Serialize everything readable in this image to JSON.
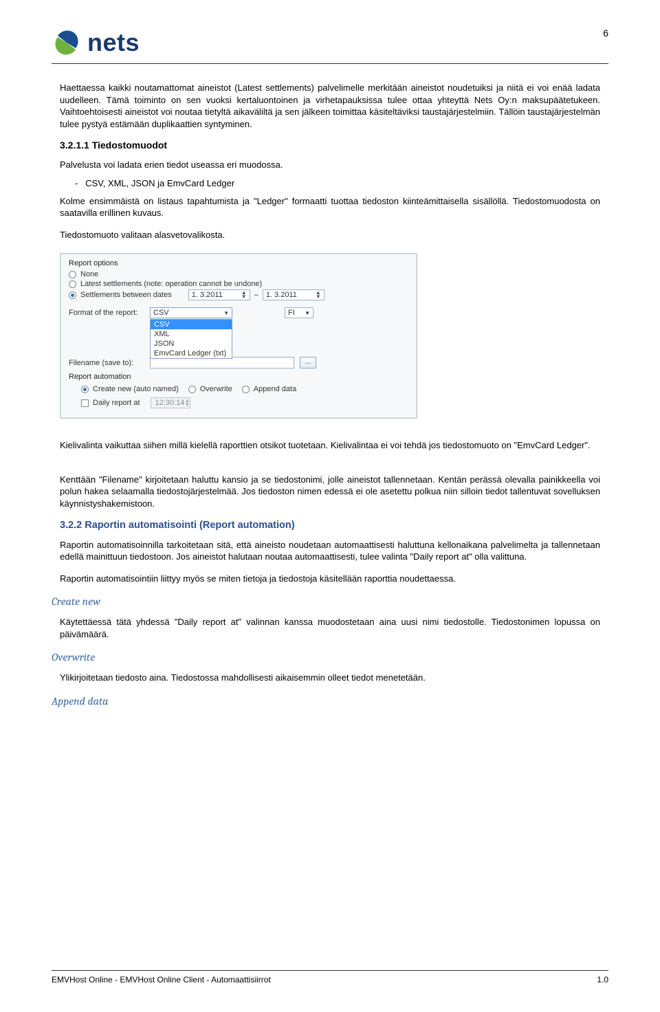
{
  "page_number": "6",
  "logo_text": "nets",
  "paragraphs": {
    "p1": "Haettaessa kaikki noutamattomat aineistot (Latest settlements) palvelimelle merkitään aineistot noudetuiksi ja niitä ei voi enää ladata uudelleen. Tämä toiminto on sen vuoksi kertaluontoinen ja virhetapauksissa tulee ottaa yhteyttä Nets Oy:n maksupäätetukeen. Vaihtoehtoisesti aineistot voi noutaa tietyltä aikaväliltä ja sen jälkeen toimittaa käsiteltäviksi taustajärjestelmiin. Tällöin taustajärjestelmän tulee pystyä estämään duplikaattien syntyminen.",
    "p2": "Palvelusta voi ladata erien tiedot useassa eri muodossa.",
    "p3_list": "CSV, XML, JSON ja EmvCard Ledger",
    "p4": "Kolme ensimmäistä on listaus tapahtumista ja \"Ledger\" formaatti tuottaa tiedoston kiinteämittaisella sisällöllä. Tiedostomuodosta on saatavilla erillinen kuvaus.",
    "p5": "Tiedostomuoto valitaan alasvetovalikosta.",
    "p6": "Kielivalinta vaikuttaa siihen millä kielellä raporttien otsikot tuotetaan. Kielivalintaa ei voi tehdä jos tiedostomuoto on \"EmvCard Ledger\".",
    "p7": "Kenttään \"Filename\" kirjoitetaan haluttu kansio ja se tiedostonimi, jolle aineistot tallennetaan. Kentän perässä olevalla painikkeella voi polun hakea selaamalla tiedostojärjestelmää. Jos tiedoston nimen edessä ei ole asetettu polkua niin silloin tiedot tallentuvat sovelluksen käynnistyshakemistoon.",
    "p8": "Raportin automatisoinnilla tarkoitetaan sitä, että aineisto noudetaan automaattisesti haluttuna kellonaikana palvelimelta ja tallennetaan edellä mainittuun tiedostoon. Jos aineistot halutaan noutaa automaattisesti, tulee valinta \"Daily report at\" olla valittuna.",
    "p9": "Raportin automatisointiin liittyy myös se miten tietoja ja tiedostoja käsitellään raporttia noudettaessa.",
    "p10": "Käytettäessä tätä yhdessä \"Daily report at\" valinnan kanssa muodostetaan aina uusi nimi tiedostolle. Tiedostonimen lopussa on päivämäärä.",
    "p11": "Ylikirjoitetaan tiedosto aina. Tiedostossa mahdollisesti aikaisemmin olleet tiedot menetetään."
  },
  "headings": {
    "h1": "3.2.1.1 Tiedostomuodot",
    "h2": "3.2.2 Raportin automatisointi (Report automation)",
    "create_new": "Create new",
    "overwrite": "Overwrite",
    "append_data": "Append data"
  },
  "screenshot": {
    "group_title": "Report options",
    "radio_none": "None",
    "radio_latest": "Latest settlements (note: operation cannot be undone)",
    "radio_between": "Settlements between dates",
    "date1": "1. 3.2011",
    "date2": "1. 3.2011",
    "date_sep": "–",
    "label_format": "Format of the report:",
    "combo_format_value": "CSV",
    "combo_options": [
      "CSV",
      "XML",
      "JSON",
      "EmvCard Ledger (txt)"
    ],
    "combo_lang": "FI",
    "label_filename": "Filename (save to):",
    "browse": "...",
    "group_auto": "Report automation",
    "radio_create": "Create new (auto named)",
    "radio_overwrite": "Overwrite",
    "radio_append": "Append data",
    "check_daily": "Daily report at",
    "time": "12:30:14"
  },
  "footer": {
    "left": "EMVHost Online - EMVHost Online Client - Automaattisiirrot",
    "right": "1.0"
  }
}
